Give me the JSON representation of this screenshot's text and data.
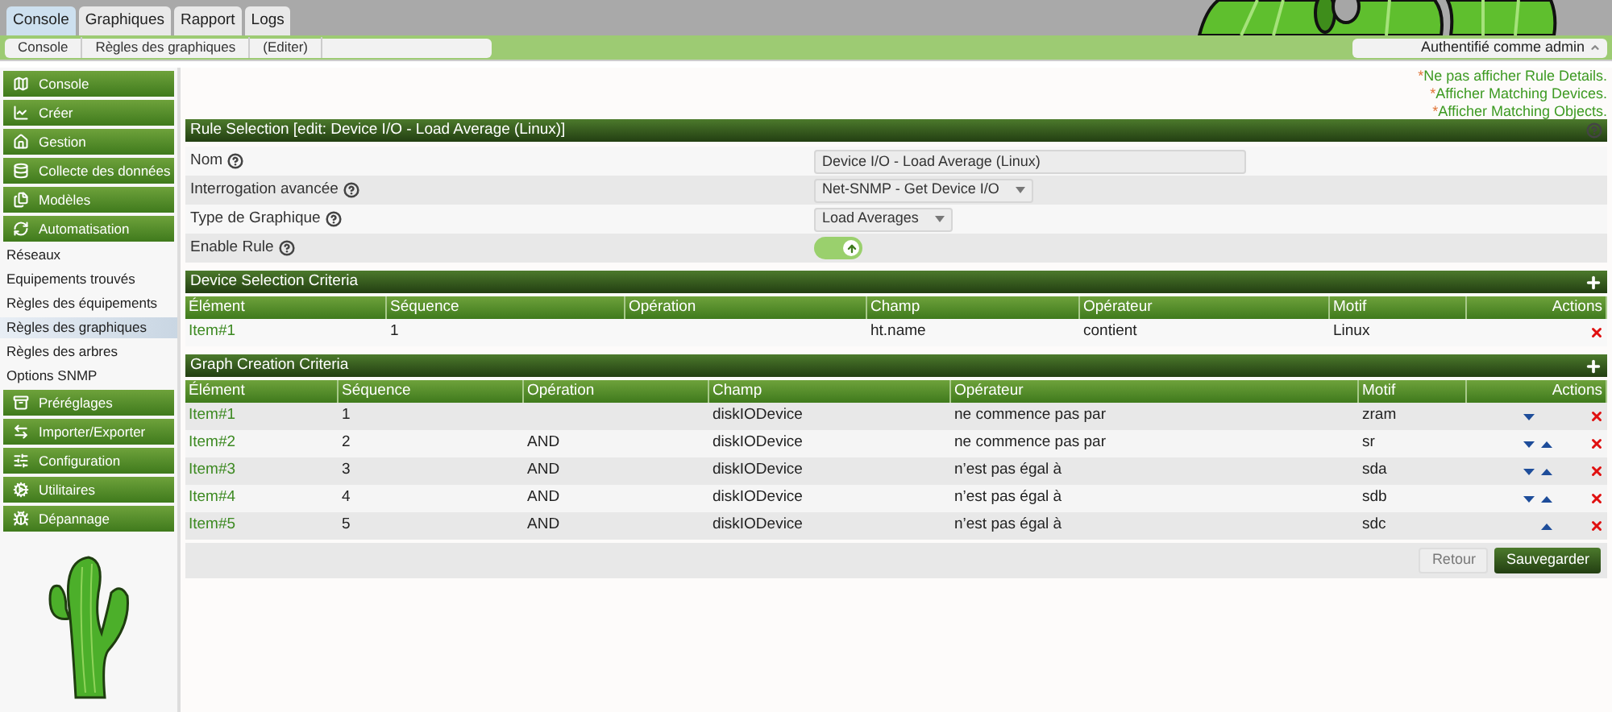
{
  "top_tabs": [
    {
      "label": "Console",
      "selected": true
    },
    {
      "label": "Graphiques",
      "selected": false
    },
    {
      "label": "Rapport",
      "selected": false
    },
    {
      "label": "Logs",
      "selected": false
    }
  ],
  "breadcrumb": [
    "Console",
    "Règles des graphiques",
    "(Editer)"
  ],
  "user_menu": {
    "label": "Authentifié comme admin"
  },
  "sidebar": {
    "items": [
      {
        "kind": "header",
        "label": "Console",
        "selected": false
      },
      {
        "kind": "header",
        "label": "Créer",
        "selected": false
      },
      {
        "kind": "header",
        "label": "Gestion",
        "selected": false
      },
      {
        "kind": "header",
        "label": "Collecte des données",
        "selected": false
      },
      {
        "kind": "header",
        "label": "Modèles",
        "selected": false
      },
      {
        "kind": "header",
        "label": "Automatisation",
        "selected": false
      },
      {
        "kind": "link",
        "label": "Réseaux",
        "selected": false
      },
      {
        "kind": "link",
        "label": "Equipements trouvés",
        "selected": false
      },
      {
        "kind": "link",
        "label": "Règles des équipements",
        "selected": false
      },
      {
        "kind": "link",
        "label": "Règles des graphiques",
        "selected": true
      },
      {
        "kind": "link",
        "label": "Règles des arbres",
        "selected": false
      },
      {
        "kind": "link",
        "label": "Options SNMP",
        "selected": false
      },
      {
        "kind": "header",
        "label": "Préréglages",
        "selected": false
      },
      {
        "kind": "header",
        "label": "Importer/Exporter",
        "selected": false
      },
      {
        "kind": "header",
        "label": "Configuration",
        "selected": false
      },
      {
        "kind": "header",
        "label": "Utilitaires",
        "selected": false
      },
      {
        "kind": "header",
        "label": "Dépannage",
        "selected": false
      }
    ]
  },
  "display_links": [
    {
      "marker": "*",
      "label": "Ne pas afficher Rule Details."
    },
    {
      "marker": "*",
      "label": "Afficher Matching Devices."
    },
    {
      "marker": "*",
      "label": "Afficher Matching Objects."
    }
  ],
  "rule_selection": {
    "title": "Rule Selection [edit: Device I/O - Load Average (Linux)]",
    "fields": [
      {
        "kind": "text",
        "label": "Nom",
        "value": "Device I/O - Load Average (Linux)"
      },
      {
        "kind": "select",
        "label": "Interrogation avancée",
        "value": "Net-SNMP - Get Device I/O"
      },
      {
        "kind": "select",
        "label": "Type de Graphique",
        "value": "Load Averages"
      },
      {
        "kind": "toggle",
        "label": "Enable Rule",
        "on": true
      }
    ]
  },
  "tables": [
    {
      "title": "Device Selection Criteria",
      "columns": [
        "Élément",
        "Séquence",
        "Opération",
        "Champ",
        "Opérateur",
        "Motif",
        "Actions"
      ],
      "rows": [
        {
          "element": "Item#1",
          "sequence": "1",
          "field": "ht.name",
          "operator": "contient",
          "pattern": "Linux",
          "move_down": false,
          "move_up": false
        }
      ]
    },
    {
      "title": "Graph Creation Criteria",
      "columns": [
        "Élément",
        "Séquence",
        "Opération",
        "Champ",
        "Opérateur",
        "Motif",
        "Actions"
      ],
      "rows": [
        {
          "element": "Item#1",
          "sequence": "1",
          "field": "diskIODevice",
          "operator": "ne commence pas par",
          "pattern": "zram",
          "move_down": true,
          "move_up": false
        },
        {
          "element": "Item#2",
          "sequence": "2",
          "operation": "AND",
          "field": "diskIODevice",
          "operator": "ne commence pas par",
          "pattern": "sr",
          "move_down": true,
          "move_up": true
        },
        {
          "element": "Item#3",
          "sequence": "3",
          "operation": "AND",
          "field": "diskIODevice",
          "operator": "n’est pas égal à",
          "pattern": "sda",
          "move_down": true,
          "move_up": true
        },
        {
          "element": "Item#4",
          "sequence": "4",
          "operation": "AND",
          "field": "diskIODevice",
          "operator": "n’est pas égal à",
          "pattern": "sdb",
          "move_down": true,
          "move_up": true
        },
        {
          "element": "Item#5",
          "sequence": "5",
          "operation": "AND",
          "field": "diskIODevice",
          "operator": "n’est pas égal à",
          "pattern": "sdc",
          "move_down": false,
          "move_up": true
        }
      ]
    }
  ],
  "buttons": [
    {
      "kind": "secondary",
      "label": "Retour"
    },
    {
      "kind": "primary",
      "label": "Sauvegarder"
    }
  ]
}
